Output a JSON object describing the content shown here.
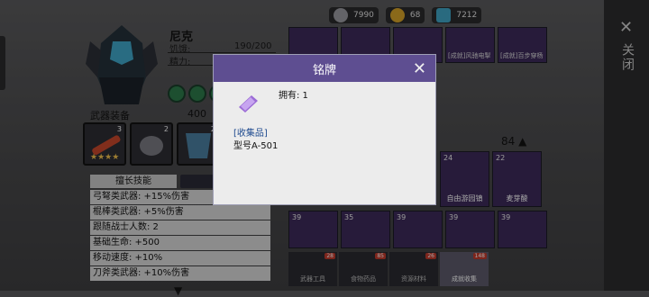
{
  "character": {
    "name": "尼克",
    "hunger_label": "饥饿:",
    "hunger_value": "190/200",
    "spirit_label": "精力:",
    "weapon_section": "武器装备",
    "attack_value": "400"
  },
  "weapons": [
    {
      "stars": "★★★★",
      "level": "3"
    },
    {
      "level": "2"
    },
    {
      "level": "2"
    }
  ],
  "skills": {
    "title": "擅长技能",
    "items": [
      "弓弩类武器: +15%伤害",
      "棍棒类武器: +5%伤害",
      "跟随战士人数: 2",
      "基础生命: +500",
      "移动速度: +10%",
      "刀斧类武器: +10%伤害"
    ]
  },
  "resources": [
    {
      "value": "7990",
      "icon": "silver-coin-icon"
    },
    {
      "value": "68",
      "icon": "gold-coin-icon"
    },
    {
      "value": "7212",
      "icon": "map-ticket-icon"
    }
  ],
  "inventory": {
    "top_row": [
      {
        "label": ""
      },
      {
        "label": ""
      },
      {
        "label": ""
      },
      {
        "label": "[成就]风驰电掣"
      },
      {
        "label": "[成就]百步穿杨"
      }
    ],
    "count": "84",
    "mid": [
      {
        "n": "24",
        "name": "自由游园镇"
      },
      {
        "n": "22",
        "name": "麦芽酸"
      }
    ],
    "bottom": [
      {
        "n": "39"
      },
      {
        "n": "35"
      },
      {
        "n": "39"
      },
      {
        "n": "39"
      },
      {
        "n": "39"
      }
    ]
  },
  "tabs": [
    {
      "label": "武器工具",
      "badge": "28"
    },
    {
      "label": "食物药品",
      "badge": "85"
    },
    {
      "label": "资源材料",
      "badge": "26"
    },
    {
      "label": "成就收集",
      "badge": "148"
    }
  ],
  "side": {
    "close": "关闭"
  },
  "dialog": {
    "title": "铭牌",
    "own": "拥有: 1",
    "category": "[收集品]",
    "model": "型号A-501"
  },
  "colors": {
    "accent": "#5e4e91",
    "item_purple": "#3c2a5a"
  }
}
